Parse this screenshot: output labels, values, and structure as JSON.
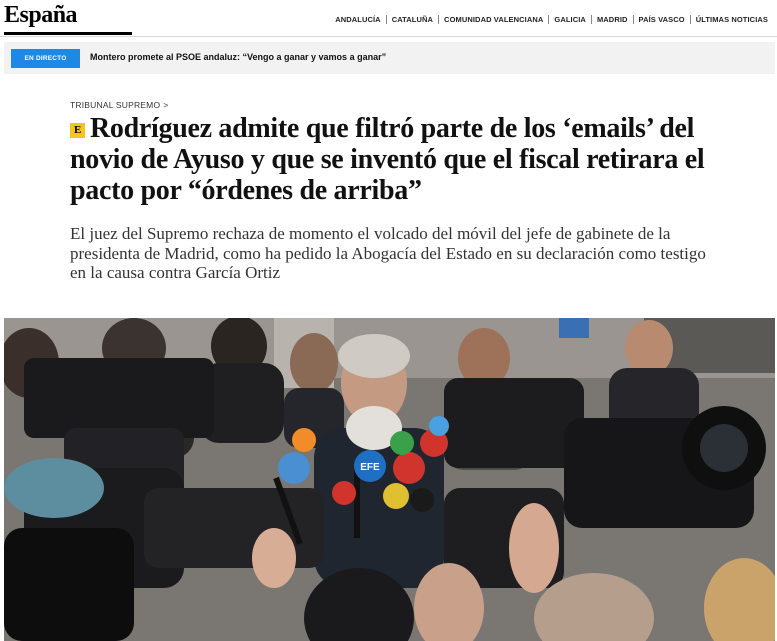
{
  "header": {
    "brand": "España",
    "regions": [
      "ANDALUCÍA",
      "CATALUÑA",
      "COMUNIDAD VALENCIANA",
      "GALICIA",
      "MADRID",
      "PAÍS VASCO",
      "ÚLTIMAS NOTICIAS"
    ]
  },
  "live": {
    "badge": "EN DIRECTO",
    "headline": "Montero promete al PSOE andaluz: “Vengo a ganar y vamos a ganar”",
    "badge_color": "#1e88e5"
  },
  "article": {
    "breadcrumb": "TRIBUNAL SUPREMO",
    "breadcrumb_chevron": ">",
    "exclusive_badge": "E",
    "headline": "Rodríguez admite que filtró parte de los ‘emails’ del novio de Ayuso y que se inventó que el fiscal retirara el pacto por “órdenes de arriba”",
    "subtitle": "El juez del Supremo rechaza de momento el volcado del móvil del jefe de gabinete de la presidenta de Madrid, como ha pedido la Abogacía del Estado en su declaración como testigo en la causa contra García Ortiz",
    "photo_microphone_label": "EFE"
  }
}
